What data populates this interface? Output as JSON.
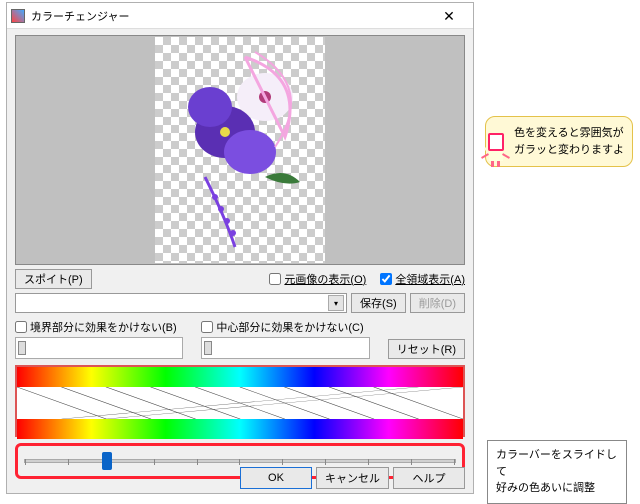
{
  "dialog": {
    "title": "カラーチェンジャー",
    "close": "✕",
    "eyedropper_btn": "スポイト(P)",
    "show_original_label": "元画像の表示(O)",
    "show_all_regions_label": "全領域表示(A)",
    "show_original_checked": false,
    "show_all_regions_checked": true,
    "save_btn": "保存(S)",
    "delete_btn": "削除(D)",
    "no_effect_border_label": "境界部分に効果をかけない(B)",
    "no_effect_center_label": "中心部分に効果をかけない(C)",
    "reset_btn": "リセット(R)",
    "ok_btn": "OK",
    "cancel_btn": "キャンセル",
    "help_btn": "ヘルプ"
  },
  "callout": {
    "line1": "色を変えると雰囲気が",
    "line2": "ガラッと変わりますよ"
  },
  "note": {
    "line1": "カラーバーをスライドして",
    "line2": "好みの色あいに調整"
  },
  "slider": {
    "value_pct": 18
  }
}
